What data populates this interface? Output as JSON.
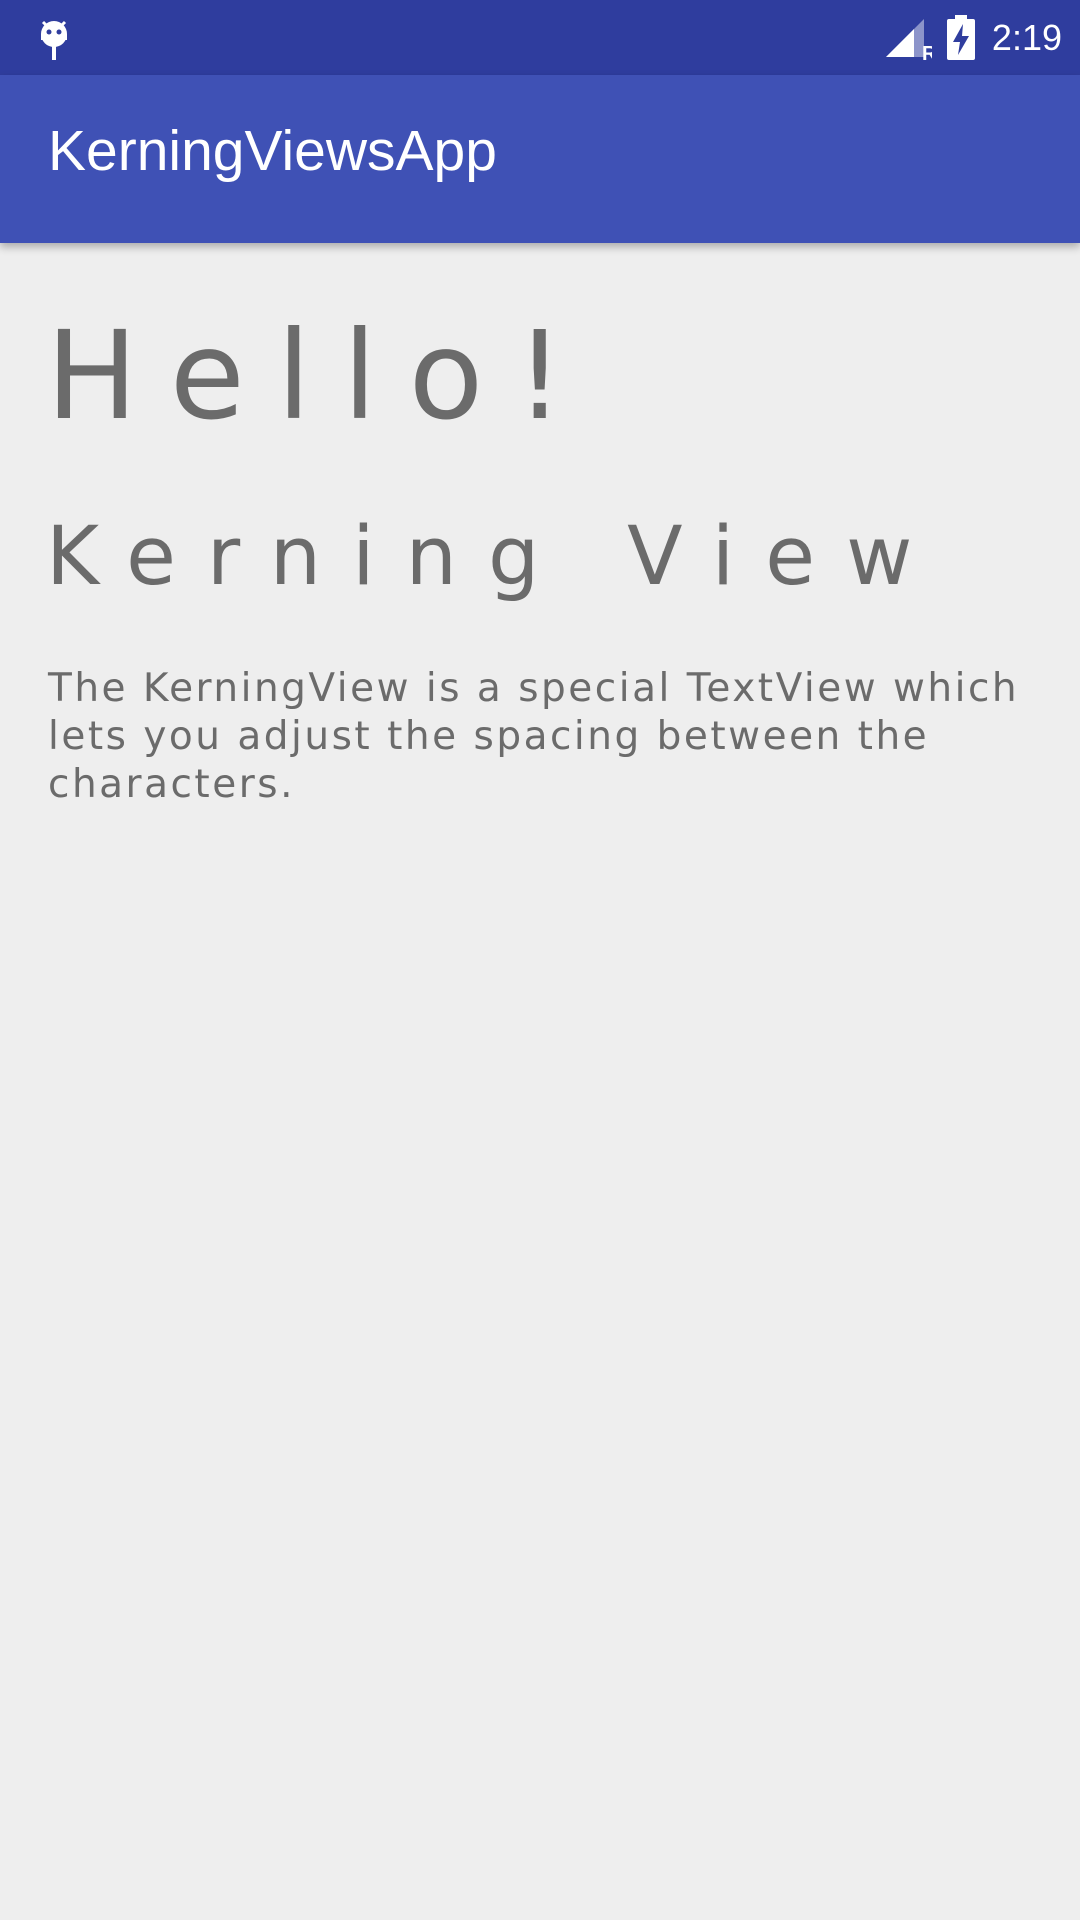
{
  "status_bar": {
    "time": "2:19",
    "network_label": "R",
    "icons": [
      "android-debug-icon",
      "signal-icon",
      "battery-charging-icon"
    ]
  },
  "app_bar": {
    "title": "KerningViewsApp"
  },
  "content": {
    "hello": "Hello!",
    "kerning_view": "Kerning View",
    "description": "The KerningView is a special TextView which lets you adjust the spacing between the characters."
  },
  "colors": {
    "status_bar": "#2f3d9e",
    "app_bar": "#3f51b5",
    "background": "#eeeeee",
    "text": "#6b6b6b"
  }
}
